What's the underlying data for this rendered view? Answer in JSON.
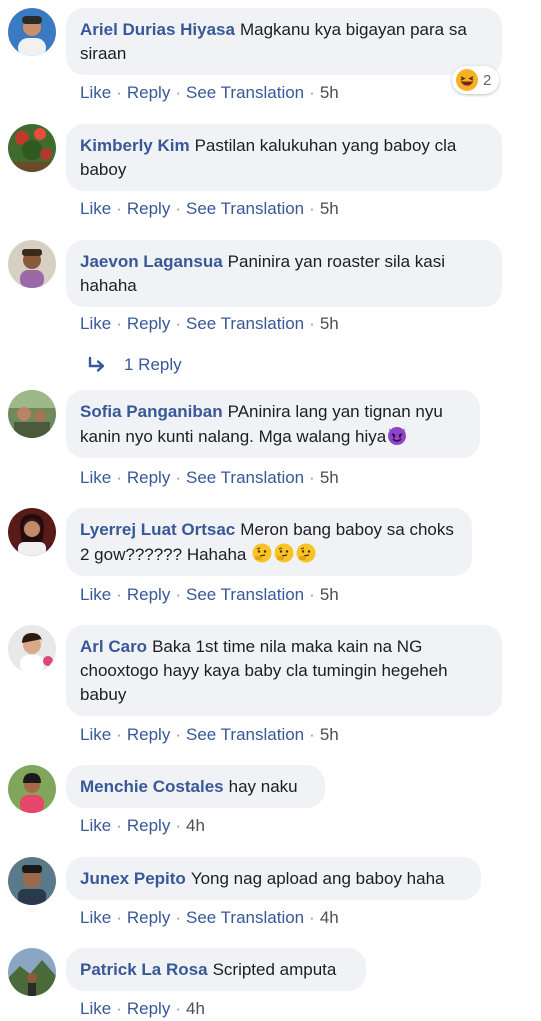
{
  "colors": {
    "author": "#385898",
    "link": "#385898",
    "bubble_bg": "#f0f2f5",
    "text": "#1c1e21",
    "meta": "#4b4f56"
  },
  "actions": {
    "like": "Like",
    "reply": "Reply",
    "see_translation": "See Translation"
  },
  "comments": [
    {
      "author": "Ariel Durias Hiyasa",
      "text": "Magkanu kya bigayan para sa siraan",
      "time": "5h",
      "reaction": {
        "icon": "laughing-emoji-icon",
        "count": "2"
      }
    },
    {
      "author": "Kimberly Kim",
      "text": "Pastilan kalukuhan yang baboy cla baboy",
      "time": "5h"
    },
    {
      "author": "Jaevon Lagansua",
      "text": "Paninira yan roaster sila kasi hahaha",
      "time": "5h",
      "replies": "1 Reply"
    },
    {
      "author": "Sofia Panganiban",
      "text": "PAninira lang yan tignan nyu kanin nyo kunti nalang. Mga walang hiya",
      "time": "5h",
      "emoji": "smiling-devil-emoji-icon"
    },
    {
      "author": "Lyerrej Luat Ortsac",
      "text": "Meron bang baboy sa choks 2 gow?????? Hahaha",
      "time": "5h",
      "emoji": "thinking-face-emoji-icon"
    },
    {
      "author": "Arl Caro",
      "text": "Baka 1st time nila maka kain na NG chooxtogo hayy kaya baby cla tumingin hegeheh babuy",
      "time": "5h"
    },
    {
      "author": "Menchie Costales",
      "text": "hay naku",
      "time": "4h"
    },
    {
      "author": "Junex Pepito",
      "text": "Yong nag apload ang baboy haha",
      "time": "4h"
    },
    {
      "author": "Patrick La Rosa",
      "text": "Scripted amputa",
      "time": "4h"
    }
  ]
}
